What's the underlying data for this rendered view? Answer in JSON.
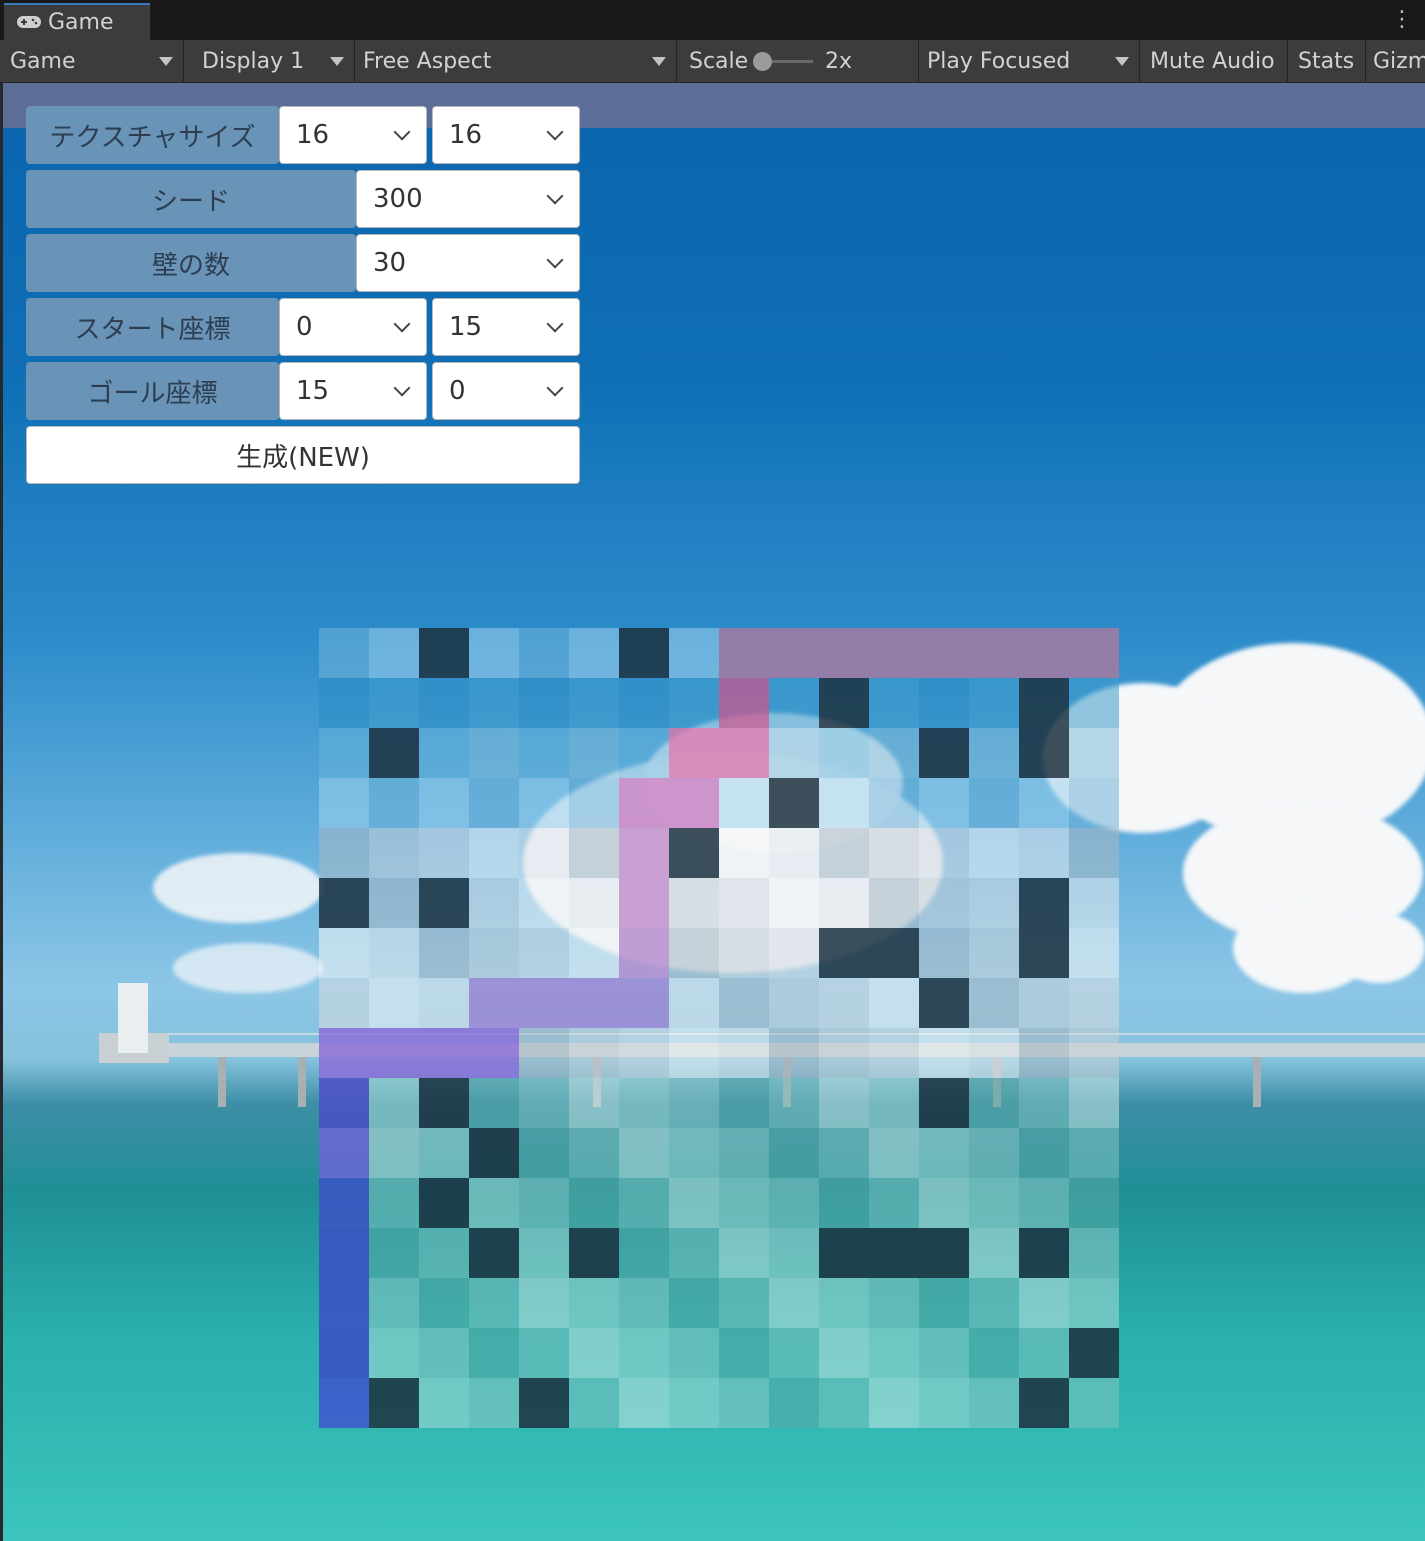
{
  "editor": {
    "tab_title": "Game",
    "toolbar": {
      "mode": "Game",
      "display": "Display 1",
      "aspect": "Free Aspect",
      "scale_label": "Scale",
      "scale_value": "2x",
      "play_mode": "Play Focused",
      "mute": "Mute Audio",
      "stats": "Stats",
      "gizmos": "Gizm"
    }
  },
  "panel": {
    "texture_size": {
      "label": "テクスチャサイズ",
      "width": "16",
      "height": "16"
    },
    "seed": {
      "label": "シード",
      "value": "300"
    },
    "wall_count": {
      "label": "壁の数",
      "value": "30"
    },
    "start": {
      "label": "スタート座標",
      "x": "0",
      "y": "15"
    },
    "goal": {
      "label": "ゴール座標",
      "x": "15",
      "y": "0"
    },
    "generate_label": "生成(NEW)"
  },
  "maze": {
    "size": 16,
    "walls": [
      [
        0,
        2
      ],
      [
        0,
        6
      ],
      [
        1,
        10
      ],
      [
        1,
        14
      ],
      [
        2,
        1
      ],
      [
        2,
        12
      ],
      [
        2,
        14
      ],
      [
        3,
        9
      ],
      [
        4,
        7
      ],
      [
        5,
        0
      ],
      [
        5,
        2
      ],
      [
        5,
        14
      ],
      [
        6,
        10
      ],
      [
        6,
        11
      ],
      [
        6,
        14
      ],
      [
        7,
        12
      ],
      [
        9,
        2
      ],
      [
        9,
        12
      ],
      [
        10,
        3
      ],
      [
        11,
        2
      ],
      [
        12,
        3
      ],
      [
        12,
        5
      ],
      [
        12,
        10
      ],
      [
        12,
        11
      ],
      [
        12,
        12
      ],
      [
        12,
        14
      ],
      [
        14,
        15
      ],
      [
        15,
        1
      ],
      [
        15,
        4
      ],
      [
        15,
        14
      ]
    ],
    "path": [
      [
        0,
        8
      ],
      [
        0,
        9
      ],
      [
        0,
        10
      ],
      [
        0,
        11
      ],
      [
        0,
        12
      ],
      [
        0,
        13
      ],
      [
        0,
        14
      ],
      [
        0,
        15
      ],
      [
        1,
        8
      ],
      [
        2,
        7
      ],
      [
        2,
        8
      ],
      [
        3,
        6
      ],
      [
        3,
        7
      ],
      [
        4,
        6
      ],
      [
        5,
        6
      ],
      [
        6,
        6
      ],
      [
        7,
        6
      ],
      [
        7,
        3
      ],
      [
        7,
        4
      ],
      [
        7,
        5
      ],
      [
        8,
        0
      ],
      [
        8,
        1
      ],
      [
        8,
        2
      ],
      [
        8,
        3
      ],
      [
        9,
        0
      ],
      [
        10,
        0
      ],
      [
        11,
        0
      ],
      [
        12,
        0
      ],
      [
        13,
        0
      ],
      [
        14,
        0
      ],
      [
        15,
        0
      ]
    ],
    "path_colors_by_row": [
      "#a47aa0",
      "#b55e95",
      "#d47ab0",
      "#c584c4",
      "#c190c9",
      "#c291cb",
      "#b78fce",
      "#9d88d4",
      "#8c70d8",
      "#4c4fc5",
      "#6b66d2",
      "#3b53c5",
      "#3c4fc6",
      "#3d4fc5",
      "#3b4ec6",
      "#3e55cf"
    ],
    "wall_color": "#1c3140",
    "palette_top": [
      "#6fb3d9",
      "#2c8cc3",
      "#66b3d8",
      "#9fd2ec",
      "#3d9acb",
      "#7fbbd9"
    ],
    "palette_mid": [
      "#e6e9ec",
      "#c9d0d5",
      "#f4f5f6",
      "#aab8c2",
      "#d8dde1"
    ],
    "palette_low": [
      "#7fc3bf",
      "#a8dbd5",
      "#5aa9a6",
      "#c6e8e4",
      "#8ec9c4"
    ]
  }
}
